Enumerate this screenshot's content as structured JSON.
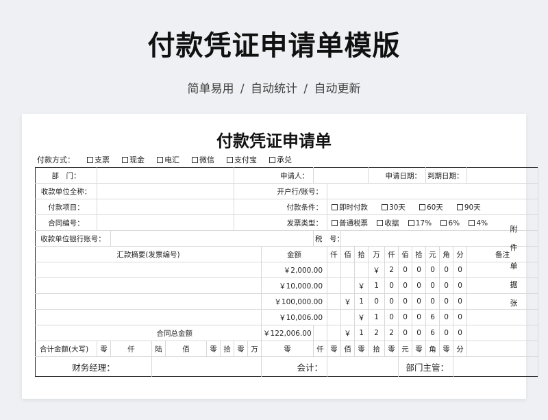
{
  "hero": {
    "title": "付款凭证申请单模版",
    "subtitle": "简单易用  /  自动统计  /  自动更新"
  },
  "form": {
    "title": "付款凭证申请单",
    "payment_method_label": "付款方式：",
    "payment_methods": [
      "支票",
      "现金",
      "电汇",
      "微信",
      "支付宝",
      "承兑"
    ],
    "labels": {
      "dept": "部　门：",
      "applicant": "申请人：",
      "apply_date": "申请日期：",
      "due_date": "到期日期：",
      "payee": "收款单位全称：",
      "bank_account": "开户行/账号：",
      "item": "付款项目：",
      "conditions": "付款条件：",
      "contract_no": "合同编号：",
      "invoice_type": "发票类型：",
      "payee_bank": "收款单位银行账号：",
      "tax_no": "税　号：",
      "summary": "汇款摘要(发票编号)",
      "amount": "金额",
      "remark": "备注",
      "contract_total": "合同总金额",
      "total_upper": "合计金额(大写)"
    },
    "conditions_options": [
      "即时付款",
      "30天",
      "60天",
      "90天"
    ],
    "invoice_options": [
      "普通税票",
      "收据",
      "17%",
      "6%",
      "4%"
    ],
    "digit_headers": [
      "仟",
      "佰",
      "拾",
      "万",
      "仟",
      "佰",
      "拾",
      "元",
      "角",
      "分"
    ],
    "rows": [
      {
        "amount": "￥2,000.00",
        "digits": [
          "",
          "",
          "",
          "￥",
          "2",
          "0",
          "0",
          "0",
          "0",
          "0"
        ]
      },
      {
        "amount": "￥10,000.00",
        "digits": [
          "",
          "",
          "￥",
          "1",
          "0",
          "0",
          "0",
          "0",
          "0",
          "0"
        ]
      },
      {
        "amount": "￥100,000.00",
        "digits": [
          "",
          "￥",
          "1",
          "0",
          "0",
          "0",
          "0",
          "0",
          "0",
          "0"
        ]
      },
      {
        "amount": "￥10,006.00",
        "digits": [
          "",
          "",
          "￥",
          "1",
          "0",
          "0",
          "0",
          "6",
          "0",
          "0"
        ]
      }
    ],
    "total": {
      "amount": "￥122,006.00",
      "digits": [
        "",
        "",
        "￥",
        "1",
        "2",
        "2",
        "0",
        "0",
        "6",
        "0",
        "0"
      ]
    },
    "upper_cells": [
      "零",
      "仟",
      "陆",
      "佰",
      "零",
      "拾",
      "零",
      "万",
      "零",
      "仟",
      "零",
      "佰",
      "零",
      "拾",
      "零",
      "元",
      "零",
      "角",
      "零",
      "分"
    ],
    "footer": {
      "finance_manager": "财务经理：",
      "accountant": "会计：",
      "dept_head": "部门主管："
    },
    "attach": [
      "附",
      "件",
      "单",
      "据",
      "张"
    ]
  }
}
